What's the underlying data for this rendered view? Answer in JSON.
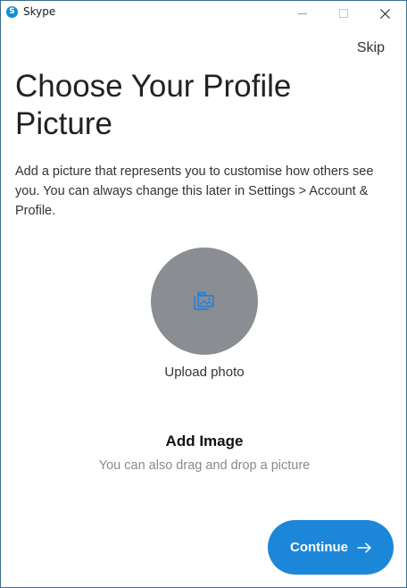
{
  "window": {
    "title": "Skype",
    "app_icon": "skype-logo-icon",
    "controls": [
      "minimize-icon",
      "maximize-icon",
      "close-icon"
    ]
  },
  "header": {
    "skip_label": "Skip"
  },
  "main": {
    "heading": "Choose Your Profile Picture",
    "description": "Add a picture that represents you to customise how others see you. You can always change this later in Settings > Account & Profile.",
    "upload": {
      "icon": "image-upload-icon",
      "label": "Upload photo"
    },
    "add_image": {
      "title": "Add Image",
      "hint": "You can also drag and drop a picture"
    }
  },
  "footer": {
    "continue_label": "Continue",
    "continue_icon": "arrow-right-icon"
  },
  "colors": {
    "accent": "#1c86d9",
    "avatar_bg": "#8a8d91",
    "icon_blue": "#0f8fd8",
    "hint_gray": "#8a8a8a"
  }
}
